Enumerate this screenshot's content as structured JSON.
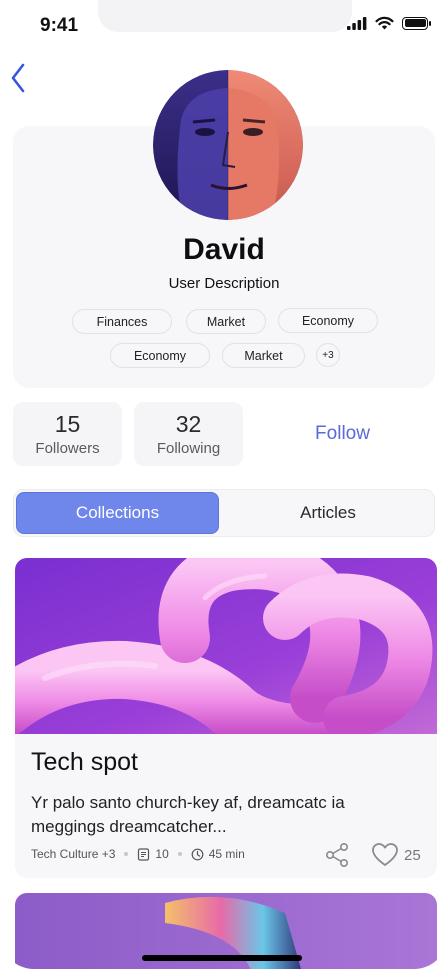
{
  "status": {
    "time": "9:41"
  },
  "profile": {
    "name": "David",
    "description": "User Description",
    "tags": [
      "Finances",
      "Market",
      "Economy",
      "Economy",
      "Market"
    ],
    "more_tags": "+3"
  },
  "stats": {
    "followers": {
      "count": "15",
      "label": "Followers"
    },
    "following": {
      "count": "32",
      "label": "Following"
    },
    "follow_label": "Follow"
  },
  "tabs": [
    "Collections",
    "Articles"
  ],
  "active_tab": "Collections",
  "collection": {
    "title": "Tech spot",
    "body": "Yr palo santo church-key af, dreamcatc ia meggings dreamcatcher...",
    "category": "Tech Culture +3",
    "articles": "10",
    "duration": "45 min",
    "likes": "25"
  },
  "colors": {
    "accent": "#6f86ea",
    "follow": "#5a6ad8",
    "back": "#3a55e0"
  },
  "icons": [
    "back-chevron-icon",
    "signal-icon",
    "wifi-icon",
    "battery-icon",
    "document-icon",
    "clock-icon",
    "share-icon",
    "heart-icon"
  ]
}
